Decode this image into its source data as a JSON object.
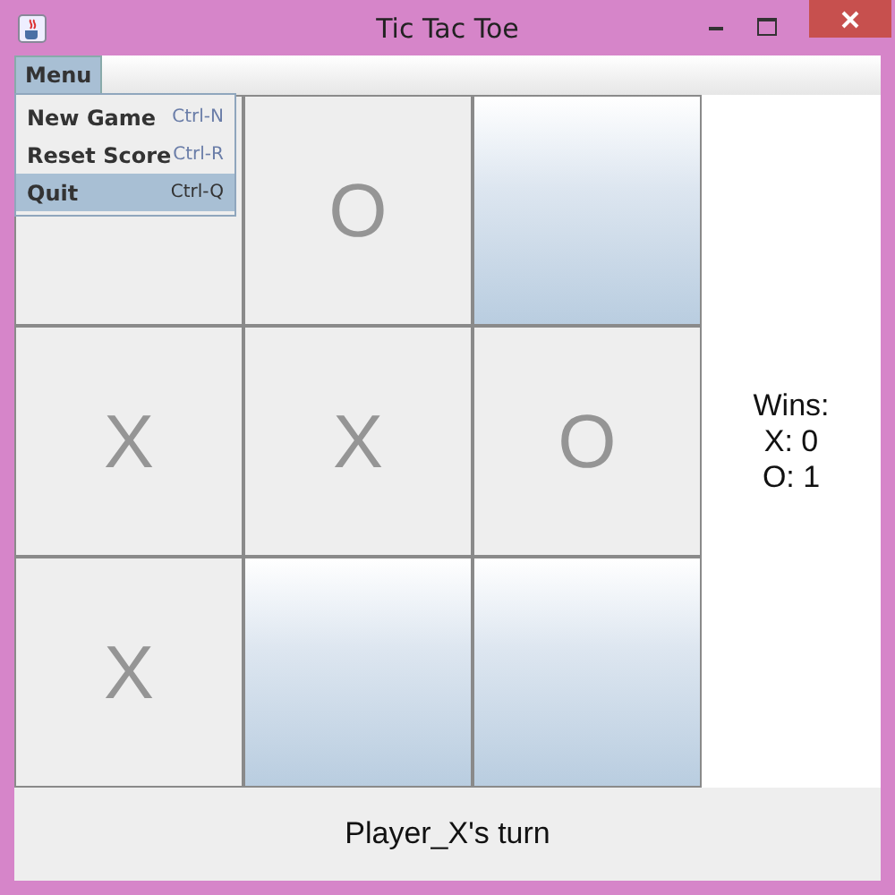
{
  "window": {
    "title": "Tic Tac Toe"
  },
  "menu_bar": {
    "menu": {
      "label": "Menu",
      "selected": true
    }
  },
  "menu_items": [
    {
      "label": "New Game",
      "shortcut": "Ctrl-N",
      "selected": false
    },
    {
      "label": "Reset Score",
      "shortcut": "Ctrl-R",
      "selected": false
    },
    {
      "label": "Quit",
      "shortcut": "Ctrl-Q",
      "selected": true
    }
  ],
  "board": [
    [
      {
        "played": true
      },
      {
        "played": true,
        "mark": "O"
      },
      {
        "played": false
      }
    ],
    [
      {
        "played": true,
        "mark": "X"
      },
      {
        "played": true,
        "mark": "X"
      },
      {
        "played": true,
        "mark": "O"
      }
    ],
    [
      {
        "played": true,
        "mark": "X"
      },
      {
        "played": false
      },
      {
        "played": false
      }
    ]
  ],
  "score": [
    "Wins:",
    "X: 0",
    "O: 1"
  ],
  "status_bar": "Player_X's turn"
}
